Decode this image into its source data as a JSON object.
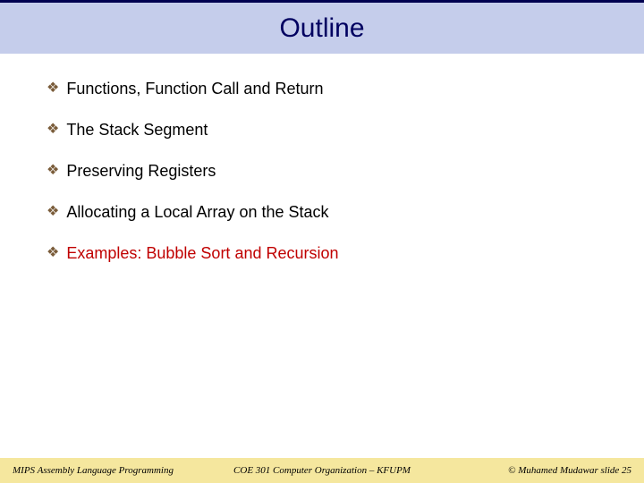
{
  "title": "Outline",
  "bullets": [
    {
      "text": "Functions, Function Call and Return",
      "active": false
    },
    {
      "text": "The Stack Segment",
      "active": false
    },
    {
      "text": "Preserving Registers",
      "active": false
    },
    {
      "text": "Allocating a Local Array on the Stack",
      "active": false
    },
    {
      "text": "Examples: Bubble Sort and Recursion",
      "active": true
    }
  ],
  "footer": {
    "left": "MIPS Assembly Language Programming",
    "center": "COE 301 Computer Organization – KFUPM",
    "right": "© Muhamed Mudawar   slide 25"
  }
}
